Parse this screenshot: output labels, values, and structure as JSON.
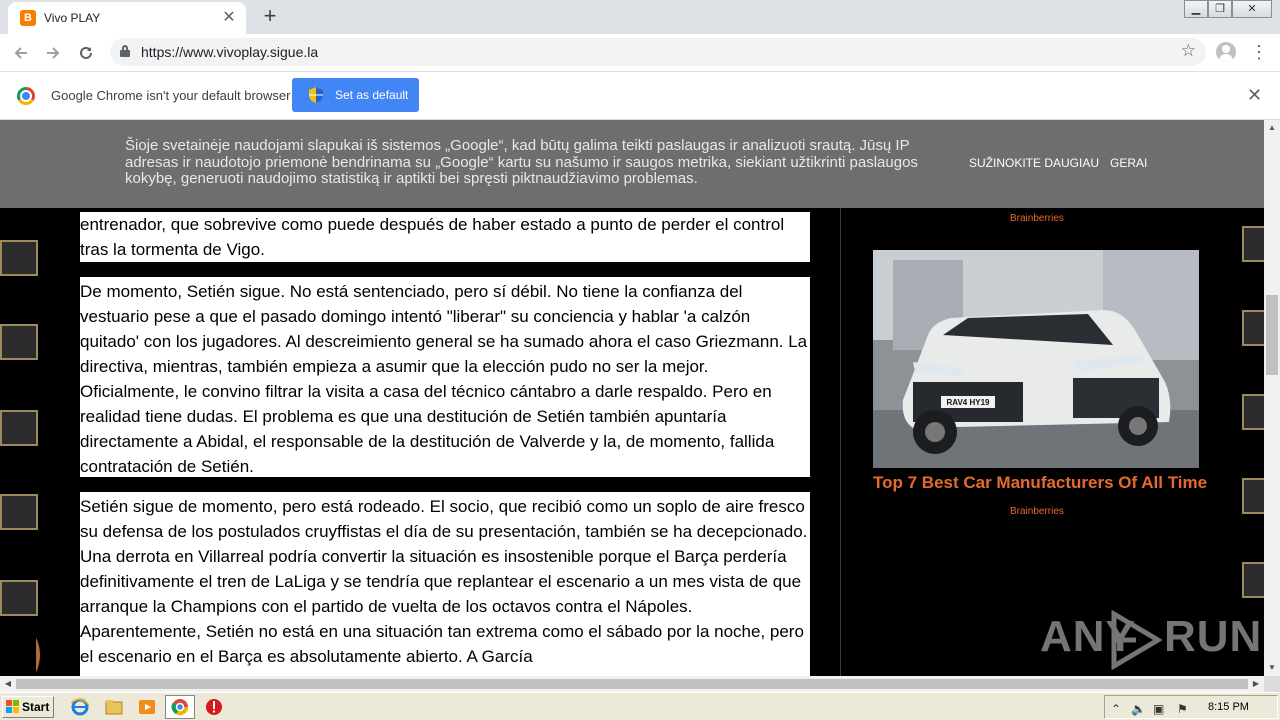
{
  "browser": {
    "tab_title": "Vivo PLAY",
    "tab_favicon_letter": "B",
    "url": "https://www.vivoplay.sigue.la",
    "window_controls": [
      "minimize",
      "restore",
      "close"
    ]
  },
  "infobar": {
    "message": "Google Chrome isn't your default browser",
    "button_label": "Set as default"
  },
  "cookie_banner": {
    "text": "Šioje svetainėje naudojami slapukai iš sistemos „Google“, kad būtų galima teikti paslaugas ir analizuoti srautą. Jūsų IP adresas ir naudotojo priemonė bendrinama su „Google“ kartu su našumo ir saugos metrika, siekiant užtikrinti paslaugos kokybę, generuoti naudojimo statistiką ir aptikti bei spręsti piktnaudžiavimo problemas.",
    "learn_more": "SUŽINOKITE DAUGIAU",
    "ok": "GERAI"
  },
  "article": {
    "paragraphs": [
      "entrenador, que sobrevive como puede después de haber estado a punto de perder el control tras la tormenta de Vigo.",
      "De momento, Setién sigue. No está sentenciado, pero sí débil. No tiene la confianza del vestuario pese a que el pasado domingo intentó \"liberar\" su conciencia y hablar 'a calzón quitado' con los jugadores. Al descreimiento general se ha sumado ahora el caso Griezmann. La directiva, mientras, también empieza a asumir que la elección pudo no ser la mejor. Oficialmente, le convino filtrar la visita a casa del técnico cántabro a darle respaldo. Pero en realidad tiene dudas. El problema es que una destitución de Setién también apuntaría directamente a Abidal, el responsable de la destitución de Valverde y la, de momento, fallida contratación de Setién.",
      "Setién sigue de momento, pero está rodeado. El socio, que recibió como un soplo de aire fresco su defensa de los postulados cruyffistas el día de su presentación, también se ha decepcionado. Una derrota en Villarreal podría convertir la situación es insostenible porque el Barça perdería definitivamente el tren de LaLiga y se tendría que replantear el escenario a un mes vista de que arranque la Champions con el partido de vuelta de los octavos contra el Nápoles. Aparentemente, Setién no está en una situación tan extrema como el sábado por la noche, pero el escenario en el Barça es absolutamente abierto. A García"
    ]
  },
  "sidebar": {
    "brand_top": "Brainberries",
    "ad_title": "Top 7 Best Car Manufacturers Of All Time",
    "brand_bottom": "Brainberries",
    "plate_text": "RAV4 HY19"
  },
  "watermark": {
    "left": "ANY",
    "right": "RUN"
  },
  "taskbar": {
    "start_label": "Start",
    "clock": "8:15 PM"
  }
}
